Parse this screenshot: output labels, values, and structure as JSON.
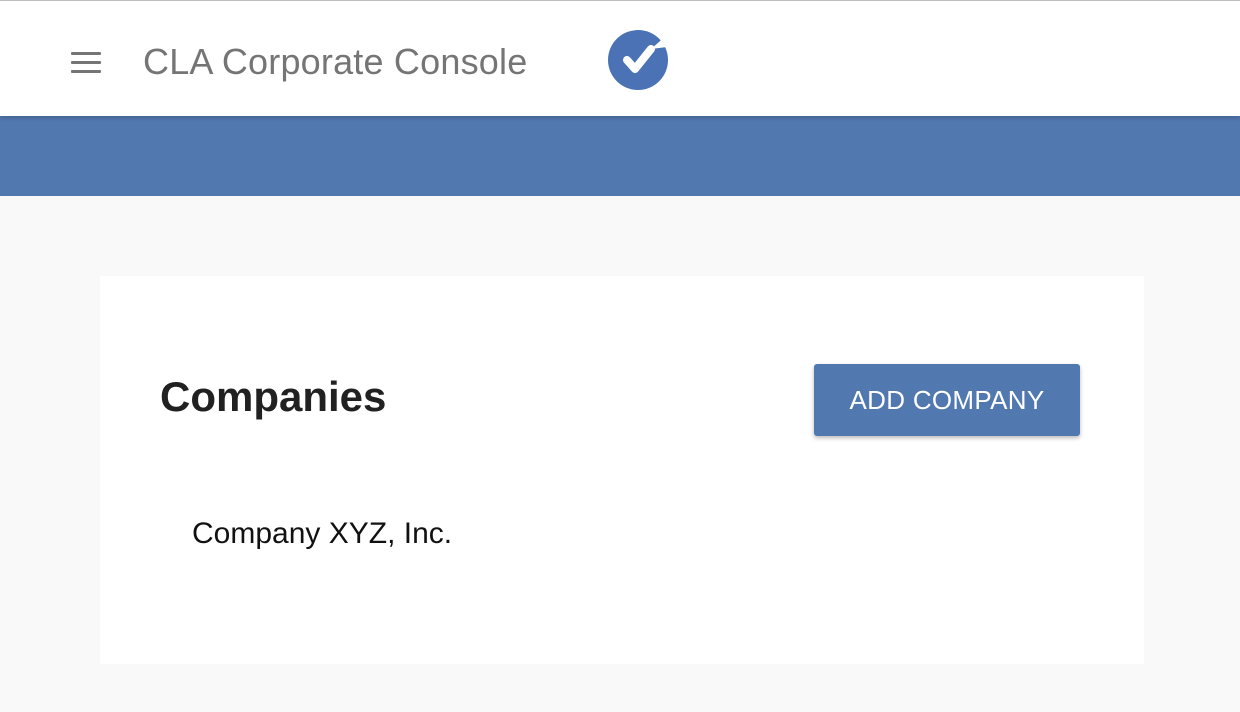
{
  "header": {
    "title": "CLA Corporate Console",
    "menu_icon": "hamburger-menu-icon",
    "logo_icon": "checkmark-logo-icon"
  },
  "companies": {
    "title": "Companies",
    "add_button_label": "ADD COMPANY",
    "items": [
      {
        "name": "Company XYZ, Inc."
      }
    ]
  },
  "colors": {
    "accent": "#5278b0",
    "title_text": "#757575",
    "background": "#f9f9f9"
  }
}
